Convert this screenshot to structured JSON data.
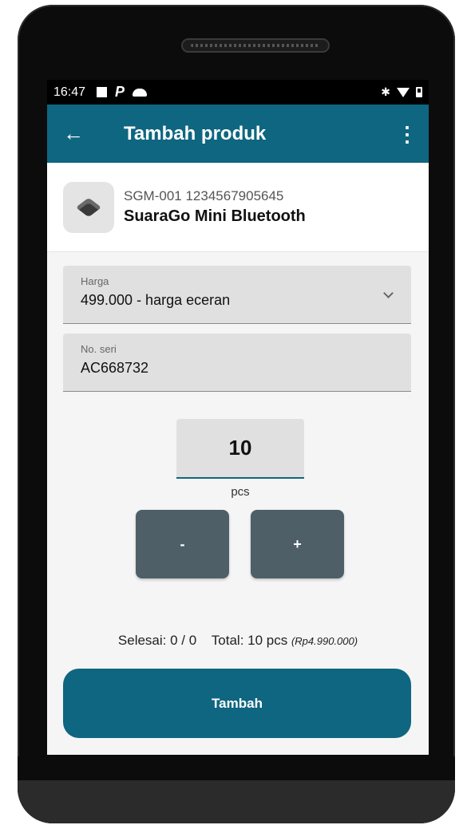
{
  "status_bar": {
    "time": "16:47",
    "bluetooth_glyph": "✱"
  },
  "app_bar": {
    "back_glyph": "←",
    "title": "Tambah produk",
    "more_glyph": "⋮"
  },
  "product": {
    "code": "SGM-001 1234567905645",
    "name": "SuaraGo Mini Bluetooth"
  },
  "price_field": {
    "label": "Harga",
    "value": "499.000 - harga eceran"
  },
  "serial_field": {
    "label": "No. seri",
    "value": "AC668732"
  },
  "quantity": {
    "value": "10",
    "unit": "pcs"
  },
  "stepper": {
    "minus_label": "-",
    "plus_label": "+"
  },
  "summary": {
    "done": "Selesai: 0 / 0",
    "total": "Total: 10 pcs",
    "amount": "(Rp4.990.000)"
  },
  "submit": {
    "label": "Tambah"
  },
  "colors": {
    "primary": "#0e6680",
    "stepper": "#4e5f68",
    "field_bg": "#e0e0e0"
  }
}
